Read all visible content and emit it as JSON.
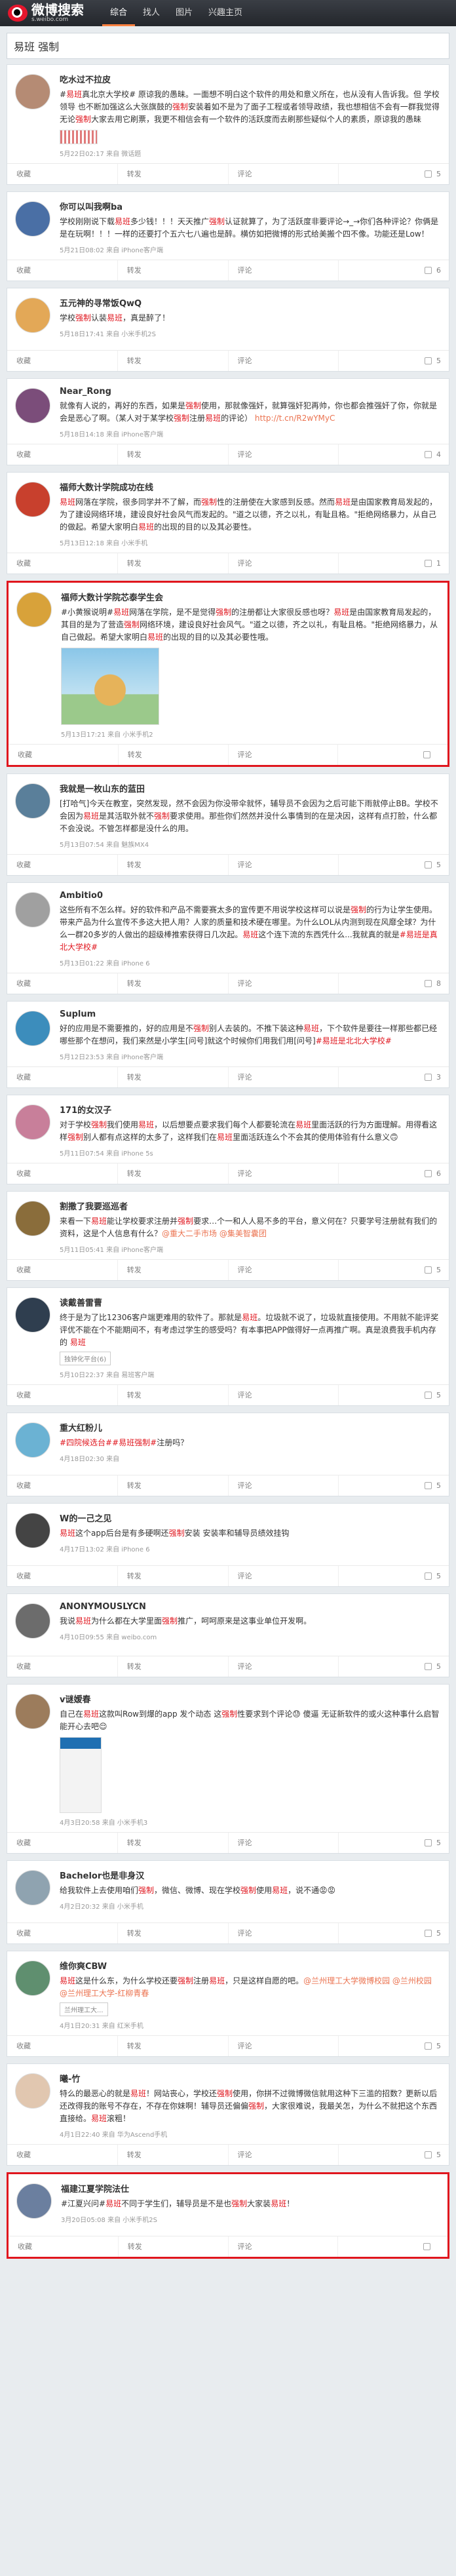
{
  "header": {
    "logo_text": "微博搜索",
    "logo_sub": "s.weibo.com",
    "nav": [
      "综合",
      "找人",
      "图片",
      "兴趣主页"
    ]
  },
  "search": {
    "query": "易班 强制"
  },
  "actions": {
    "collect": "收藏",
    "repost": "转发",
    "comment": "评论",
    "like": "赞"
  },
  "posts": [
    {
      "user": "吃水过不拉皮",
      "segments": [
        {
          "t": "#"
        },
        {
          "t": "易班",
          "k": 1
        },
        {
          "t": "真北京大学校#"
        },
        {
          "t": " 原谅我的愚昧。一面想不明白这个软件的用处和意义所在，也从没有人告诉我。但 "
        },
        {
          "t": "学校领导"
        },
        {
          "t": " 也不断加强这么大张旗鼓的"
        },
        {
          "t": "强制",
          "k": 1
        },
        {
          "t": "安装着如不是为了面子工程或者领导政绩，我也想相信不会有一群我觉得无论"
        },
        {
          "t": "强制",
          "k": 1
        },
        {
          "t": "大家去用它刷票，我更不相信会有一个软件的活跃度而去刷那些疑似个人的素质，原谅我的愚昧"
        }
      ],
      "meta": "5月22日02:17 来自 微话题",
      "has_pic": "stamp",
      "comments": "",
      "likes": "5"
    },
    {
      "user": "你可以叫我啊ba",
      "segments": [
        {
          "t": "学校刚刚说下载"
        },
        {
          "t": "易班",
          "k": 1
        },
        {
          "t": "多少钱！！！天天推广"
        },
        {
          "t": "强制",
          "k": 1
        },
        {
          "t": "认证就算了，为了活跃度非要评论→_→你们各种评论？你俩是是在玩啊！！！一样的还要打个五六七八遍也是醉。横仿如把微博的形式给美搬个四不像。功能还是Low！"
        }
      ],
      "meta": "5月21日08:02 来自 iPhone客户端",
      "comments": "",
      "likes": "6"
    },
    {
      "user": "五元神的寻常饭QwQ",
      "segments": [
        {
          "t": "学校"
        },
        {
          "t": "强制",
          "k": 1
        },
        {
          "t": "认装"
        },
        {
          "t": "易班",
          "k": 1
        },
        {
          "t": "，真是醉了！"
        }
      ],
      "meta": "5月18日17:41 来自 小米手机2S",
      "comments": "",
      "likes": "5"
    },
    {
      "user": "Near_Rong",
      "segments": [
        {
          "t": "就像有人说的，再好的东西，如果是"
        },
        {
          "t": "强制",
          "k": 1
        },
        {
          "t": "使用，那就像强奸，就算强奸犯再帅，你也都会推强奸了你，你就是会是恶心了啊。（某人对于某学校"
        },
        {
          "t": "强制",
          "k": 1
        },
        {
          "t": "注册"
        },
        {
          "t": "易班",
          "k": 1
        },
        {
          "t": "的评论）"
        },
        {
          "t": " http://t.cn/R2wYMyC",
          "l": 1
        }
      ],
      "meta": "5月18日14:18 来自 iPhone客户端",
      "comments": "",
      "likes": "4"
    },
    {
      "user": "福师大数计学院成功在线",
      "segments": [
        {
          "t": "易班",
          "k": 1
        },
        {
          "t": "网落在学院，很多同学并不了解，而"
        },
        {
          "t": "强制",
          "k": 1
        },
        {
          "t": "性的注册使在大家感到反感。然而"
        },
        {
          "t": "易班",
          "k": 1
        },
        {
          "t": "是由国家教育局发起的，为了建设网络环境，建设良好社会风气而发起的。\"道之以德，齐之以礼，有耻且格。\"拒绝网络暴力，从自己的做起。希望大家明白"
        },
        {
          "t": "易班",
          "k": 1
        },
        {
          "t": "的出现的目的以及其必要性。"
        }
      ],
      "meta": "5月13日12:18 来自 小米手机",
      "comments": "",
      "likes": "1"
    },
    {
      "user": "福师大数计学院芯泰学生会",
      "highlight": true,
      "segments": [
        {
          "t": "#小黄猴说明#"
        },
        {
          "t": "易班",
          "k": 1
        },
        {
          "t": "网落在学院，是不是觉得"
        },
        {
          "t": "强制",
          "k": 1
        },
        {
          "t": "的注册都让大家很反感也呀？"
        },
        {
          "t": "易班",
          "k": 1
        },
        {
          "t": "是由国家教育局发起的，其目的是为了营造"
        },
        {
          "t": "强制",
          "k": 1
        },
        {
          "t": "网络环境，建设良好社会风气。\"道之以德，齐之以礼，有耻且格。\"拒绝网络暴力，从自己做起。希望大家明白"
        },
        {
          "t": "易班",
          "k": 1
        },
        {
          "t": "的出现的目的以及其必要性哦。"
        }
      ],
      "meta": "5月13日17:21 来自 小米手机2",
      "has_pic": "cartoon",
      "comments": "",
      "likes": ""
    },
    {
      "user": "我就是一枚山东的蓝田",
      "segments": [
        {
          "t": "[打哈气]今天在教室，突然发现，然不会因为你没带伞就怀，辅导员不会因为之后可能下雨就停止BB。学校不会因为"
        },
        {
          "t": "易班",
          "k": 1
        },
        {
          "t": "是其活取外就不"
        },
        {
          "t": "强制",
          "k": 1
        },
        {
          "t": "要求使用。那些你们然然并没什么事情到的在是决因，这样有点打脸，什么都不会没说。不管怎样都是没什么的用。"
        }
      ],
      "meta": "5月13日07:54 来自 魅族MX4",
      "comments": "",
      "likes": "5"
    },
    {
      "user": "Ambitio0",
      "segments": [
        {
          "t": "这些所有不怎么样。好的软件和产品不需要赛太多的宣传更不用说学校这样可以说是"
        },
        {
          "t": "强制",
          "k": 1
        },
        {
          "t": "的行为让学生使用。带来产品为什么宣传不多这大把人用？人家的质量和技术硬在哪里。为什么LOL从内测到现在风靡全球？为什么一群20多岁的人做出的超级棒推索获得日几次起。"
        },
        {
          "t": "易班",
          "k": 1
        },
        {
          "t": "这个连下流的东西凭什么...我就真的就是"
        },
        {
          "t": "#易班是真北大学校#",
          "k": 1
        }
      ],
      "meta": "5月13日01:22 来自 iPhone 6",
      "comments": "",
      "likes": "8"
    },
    {
      "user": "Suplum",
      "segments": [
        {
          "t": "好的应用是不需要推的，好的应用是不"
        },
        {
          "t": "强制",
          "k": 1
        },
        {
          "t": "别人去装的。不推下装这种"
        },
        {
          "t": "易班",
          "k": 1
        },
        {
          "t": "，下个软件是要往一样那些都已经哪些那个在想问，我们来然是小学生[问号]就这个时候你们用我们用[问号]"
        },
        {
          "t": "#易班是北北大学校#",
          "k": 1
        }
      ],
      "meta": "5月12日23:53 来自 iPhone客户端",
      "comments": "",
      "likes": "3"
    },
    {
      "user": "171的女汉子",
      "segments": [
        {
          "t": "对于学校"
        },
        {
          "t": "强制",
          "k": 1
        },
        {
          "t": "我们使用"
        },
        {
          "t": "易班",
          "k": 1
        },
        {
          "t": "，以后想要点要求我们每个人都要轮流在"
        },
        {
          "t": "易班",
          "k": 1
        },
        {
          "t": "里面活跃的行为方面理解。用得看这样"
        },
        {
          "t": "强制",
          "k": 1
        },
        {
          "t": "别人都有点这样的太多了，这样我们在"
        },
        {
          "t": "易班",
          "k": 1
        },
        {
          "t": "里面活跃连么个不会其的使用体验有什么意义🙃"
        }
      ],
      "meta": "5月11日07:54 来自 iPhone 5s",
      "comments": "",
      "likes": "6"
    },
    {
      "user": "割撒了我要巡巡者",
      "segments": [
        {
          "t": "来看一下"
        },
        {
          "t": "易班",
          "k": 1
        },
        {
          "t": "能让学校要求注册并"
        },
        {
          "t": "强制",
          "k": 1
        },
        {
          "t": "要求…个一和人人易不多的平台，意义何在？只要学号注册就有我们的资料，这是个人信息有什么？"
        },
        {
          "t": "@重大二手市场 @集美智囊团",
          "l": 1
        }
      ],
      "meta": "5月11日05:41 来自 iPhone客户端",
      "comments": "",
      "likes": "5"
    },
    {
      "user": "读戴善雷曹",
      "segments": [
        {
          "t": "终于是为了比12306客户端更难用的软件了。那就是"
        },
        {
          "t": "易班",
          "k": 1
        },
        {
          "t": "。垃圾就不说了，垃圾就直接使用。不用就不能评奖评优不能在个不能期间不，有考虑过学生的感受吗？有本事把APP做得好一点再推广啊。真是浪费我手机内存"
        },
        {
          "t": " 的 "
        },
        {
          "t": "易班",
          "k": 1
        }
      ],
      "link_box": "独钟化平台(6)",
      "meta": "5月10日22:37 来自 易班客户端",
      "comments": "",
      "likes": "5"
    },
    {
      "user": "重大红粉儿",
      "segments": [
        {
          "t": "#四院候选台#",
          "k": 1
        },
        {
          "t": "#易班强制#",
          "k": 1
        },
        {
          "t": "注册吗？"
        }
      ],
      "meta": "4月18日02:30 来自",
      "comments": "",
      "likes": "5"
    },
    {
      "user": "W的一己之见",
      "segments": [
        {
          "t": "易班",
          "k": 1
        },
        {
          "t": "这个app后台是有多硬啊还"
        },
        {
          "t": "强制",
          "k": 1
        },
        {
          "t": "安装 安装率和辅导员绩效挂钩"
        }
      ],
      "meta": "4月17日13:02 来自 iPhone 6",
      "comments": "",
      "likes": "5"
    },
    {
      "user": "ANONYMOUSLYCN",
      "segments": [
        {
          "t": "我说"
        },
        {
          "t": "易班",
          "k": 1
        },
        {
          "t": "为什么都在大学里面"
        },
        {
          "t": "强制",
          "k": 1
        },
        {
          "t": "推广，呵呵原来是这事业单位开发啊。"
        }
      ],
      "meta": "4月10日09:55 来自 weibo.com",
      "comments": "",
      "likes": "5"
    },
    {
      "user": "v谜嫒春",
      "segments": [
        {
          "t": "自己在"
        },
        {
          "t": "易班",
          "k": 1
        },
        {
          "t": "这款叫Row到爆的app 发个动态 这"
        },
        {
          "t": "强制",
          "k": 1
        },
        {
          "t": "性要求到个评论😓 傻逼 无证新软件的或火这种事什么启智能开心去吧😌"
        }
      ],
      "meta": "4月3日20:58 来自 小米手机3",
      "has_pic": "screen",
      "comments": "",
      "likes": "5"
    },
    {
      "user": "Bachelor也是非身汉",
      "segments": [
        {
          "t": "给我软件上去使用咱们"
        },
        {
          "t": "强制",
          "k": 1
        },
        {
          "t": "，微信、微博、现在学校"
        },
        {
          "t": "强制",
          "k": 1
        },
        {
          "t": "使用"
        },
        {
          "t": "易班",
          "k": 1
        },
        {
          "t": "，说不通😡😡"
        }
      ],
      "meta": "4月2日20:32 来自 小米手机",
      "comments": "",
      "likes": "5"
    },
    {
      "user": "维你爽CBW",
      "segments": [
        {
          "t": "易班",
          "k": 1
        },
        {
          "t": "这是什么东，为什么学校还要"
        },
        {
          "t": "强制",
          "k": 1
        },
        {
          "t": "注册"
        },
        {
          "t": "易班",
          "k": 1
        },
        {
          "t": "，只是这样自愿的吧。"
        },
        {
          "t": "@兰州理工大学微博校园 @兰州校园 @兰州理工大学-红柳青春",
          "l": 1
        }
      ],
      "link_box": "兰州理工大...",
      "meta": "4月1日20:31 来自 红米手机",
      "comments": "",
      "likes": "5"
    },
    {
      "user": "曦-竹",
      "segments": [
        {
          "t": "特么的最恶心的就是"
        },
        {
          "t": "易班",
          "k": 1
        },
        {
          "t": "！网站丧心，学校还"
        },
        {
          "t": "强制",
          "k": 1
        },
        {
          "t": "使用，你拼不过微博微信就用这种下三滥的招数？更新以后还改得我的账号不存在，不存在你妹啊！辅导员还偏偏"
        },
        {
          "t": "强制",
          "k": 1
        },
        {
          "t": "，大家很难说，我最关怎，为什么不就把这个东西直接给。"
        },
        {
          "t": "易班",
          "k": 1
        },
        {
          "t": "滚粗！"
        }
      ],
      "meta": "4月1日22:40 来自 华为Ascend手机",
      "comments": "",
      "likes": "5"
    },
    {
      "user": "福建江夏学院法仕",
      "highlight": true,
      "segments": [
        {
          "t": "#江夏兴问#"
        },
        {
          "t": "易班",
          "k": 1
        },
        {
          "t": "不同于学生们，辅导员是不是也"
        },
        {
          "t": "强制",
          "k": 1
        },
        {
          "t": "大家装"
        },
        {
          "t": "易班",
          "k": 1
        },
        {
          "t": "！"
        }
      ],
      "meta": "3月20日05:08 来自 小米手机2S",
      "comments": "",
      "likes": ""
    }
  ]
}
